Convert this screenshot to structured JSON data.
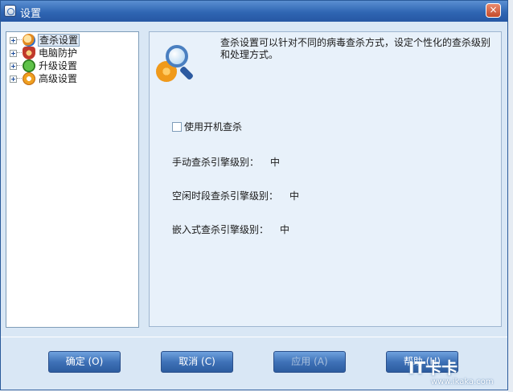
{
  "window": {
    "title": "设置",
    "close_glyph": "×"
  },
  "tree": {
    "items": [
      {
        "label": "查杀设置",
        "icon": "search-gear-icon",
        "selected": true
      },
      {
        "label": "电脑防护",
        "icon": "shield-icon",
        "selected": false
      },
      {
        "label": "升级设置",
        "icon": "check-icon",
        "selected": false
      },
      {
        "label": "高级设置",
        "icon": "gear-icon",
        "selected": false
      }
    ]
  },
  "content": {
    "description": "查杀设置可以针对不同的病毒查杀方式，设定个性化的查杀级别和处理方式。",
    "boot_scan": {
      "label": "使用开机查杀",
      "checked": false
    },
    "settings": [
      {
        "label": "手动查杀引擎级别：",
        "value": "中"
      },
      {
        "label": "空闲时段查杀引擎级别：",
        "value": "中"
      },
      {
        "label": "嵌入式查杀引擎级别：",
        "value": "中"
      }
    ]
  },
  "buttons": {
    "ok": "确定 (O)",
    "cancel": "取消 (C)",
    "apply": "应用 (A)",
    "help": "帮助 (H)"
  },
  "watermark": {
    "logo": "IT卡卡",
    "url": "www.ikaka.com"
  }
}
